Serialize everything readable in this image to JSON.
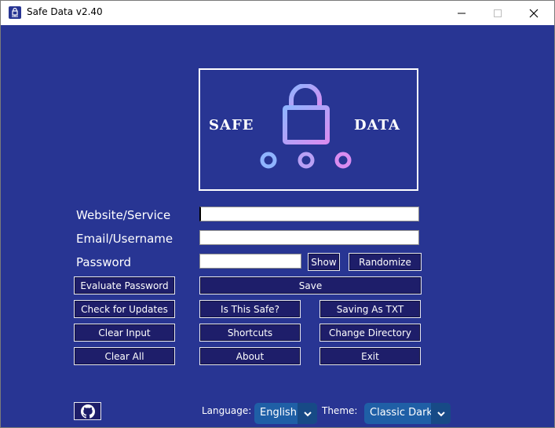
{
  "window": {
    "title": "Safe Data v2.40"
  },
  "logo": {
    "left_text": "SAFE",
    "right_text": "DATA"
  },
  "form": {
    "website_label": "Website/Service",
    "email_label": "Email/Username",
    "password_label": "Password",
    "website_value": "",
    "email_value": "",
    "password_value": ""
  },
  "buttons": {
    "show": "Show",
    "randomize": "Randomize",
    "evaluate": "Evaluate Password",
    "save": "Save",
    "check_updates": "Check for Updates",
    "is_safe": "Is This Safe?",
    "saving_as": "Saving As TXT",
    "clear_input": "Clear Input",
    "shortcuts": "Shortcuts",
    "change_directory": "Change Directory",
    "clear_all": "Clear All",
    "about": "About",
    "exit": "Exit"
  },
  "footer": {
    "language_label": "Language:",
    "language_value": "English",
    "theme_label": "Theme:",
    "theme_value": "Classic Dark"
  },
  "colors": {
    "background": "#283593",
    "button": "#1e1e6a",
    "combo": "#1f5fa6"
  }
}
